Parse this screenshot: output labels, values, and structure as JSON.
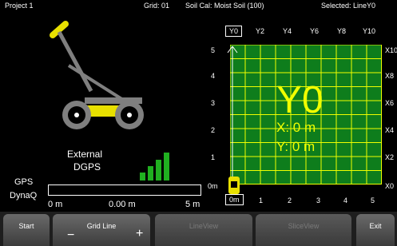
{
  "status_bar": {
    "project": "Project 1",
    "grid": "Grid: 01",
    "soil_cal": "Soil Cal: Moist Soil (100)",
    "selected": "Selected: LineY0"
  },
  "line_tabs": [
    "Y0",
    "Y2",
    "Y4",
    "Y6",
    "Y8",
    "Y10"
  ],
  "selected_tab": "Y0",
  "grid": {
    "y_axis_labels": [
      "5",
      "4",
      "3",
      "2",
      "1",
      "0m"
    ],
    "x_axis_labels": [
      "0m",
      "1",
      "2",
      "3",
      "4",
      "5"
    ],
    "right_labels": [
      "X10",
      "X8",
      "X6",
      "X4",
      "X2",
      "X0"
    ],
    "current_line": "Y0",
    "x_readout": "X:  0  m",
    "y_readout": "Y:  0  m",
    "line_color": "#f0ff00",
    "grid_color": "#0e7d1c"
  },
  "gps": {
    "label": "GPS",
    "source_line1": "External",
    "source_line2": "DGPS",
    "signal_bars_lit": 4,
    "signal_bars_total": 4
  },
  "dynaq": {
    "label": "DynaQ",
    "start": "0 m",
    "value": "0.00 m",
    "end": "5 m",
    "progress_fraction": 0
  },
  "buttons": {
    "start": "Start",
    "grid_line": "Grid Line",
    "minus": "−",
    "plus": "+",
    "lineview": "LineView",
    "sliceview": "SliceView",
    "exit": "Exit"
  },
  "colors": {
    "cart_yellow": "#e8e000",
    "cart_gray": "#7f7f7f",
    "signal_green": "#20b020"
  }
}
